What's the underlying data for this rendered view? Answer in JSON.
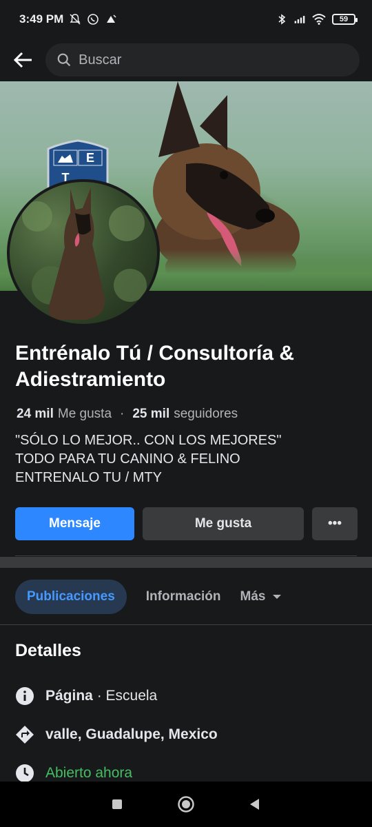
{
  "status_bar": {
    "time": "3:49 PM",
    "battery": "59",
    "icons": [
      "mute-icon",
      "whatsapp-icon",
      "notification-icon",
      "bluetooth-icon",
      "signal-icon",
      "wifi-icon",
      "battery-icon"
    ]
  },
  "header": {
    "search_placeholder": "Buscar"
  },
  "cover": {
    "logo_letters": [
      "E",
      "T"
    ]
  },
  "page": {
    "title": "Entrénalo  Tú / Consultoría & Adiestramiento",
    "likes_count": "24 mil",
    "likes_label": "Me gusta",
    "followers_count": "25 mil",
    "followers_label": "seguidores",
    "bio": [
      "\"SÓLO LO MEJOR.. CON LOS MEJORES\"",
      "TODO PARA TU CANINO & FELINO",
      "ENTRENALO TU / MTY"
    ]
  },
  "actions": {
    "message": "Mensaje",
    "like": "Me gusta",
    "more": "•••"
  },
  "tabs": {
    "posts": "Publicaciones",
    "info": "Información",
    "more": "Más"
  },
  "details": {
    "title": "Detalles",
    "category_label": "Página",
    "category_value": " · Escuela",
    "location": "valle, Guadalupe, Mexico",
    "hours": "Abierto ahora"
  },
  "colors": {
    "accent": "#2d88ff",
    "open_status": "#45bd62",
    "background": "#18191a"
  }
}
